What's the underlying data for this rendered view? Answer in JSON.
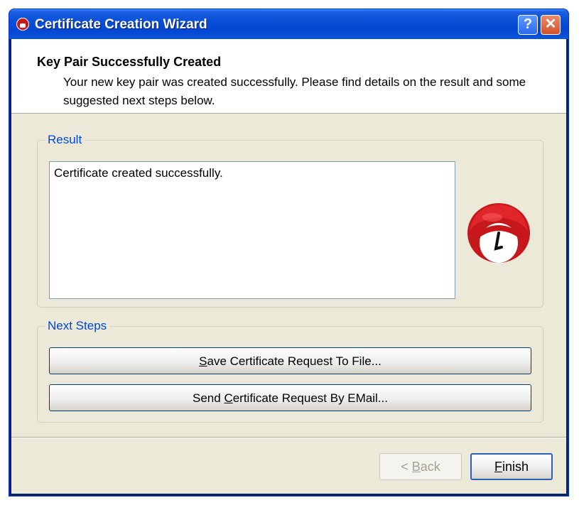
{
  "window": {
    "title": "Certificate Creation Wizard",
    "help_label": "?",
    "close_label": "✕"
  },
  "header": {
    "title": "Key Pair Successfully Created",
    "description": "Your new key pair was created successfully. Please find details on the result and some suggested next steps below."
  },
  "result": {
    "group_label": "Result",
    "text": "Certificate created successfully."
  },
  "next_steps": {
    "group_label": "Next Steps",
    "save_button": {
      "mnemonic": "S",
      "rest": "ave Certificate Request To File..."
    },
    "send_button": {
      "before": "Send ",
      "mnemonic": "C",
      "rest": "ertificate Request By EMail..."
    }
  },
  "footer": {
    "back_button": {
      "before": "< ",
      "mnemonic": "B",
      "rest": "ack"
    },
    "finish_button": {
      "mnemonic": "F",
      "rest": "inish"
    }
  },
  "colors": {
    "titlebar": "#0a4fd6",
    "group_title": "#0046d5",
    "dialog_bg": "#ece9d8",
    "mascot_red": "#c6171a"
  },
  "icons": {
    "app": "app-icon",
    "mascot": "mascot-icon"
  }
}
